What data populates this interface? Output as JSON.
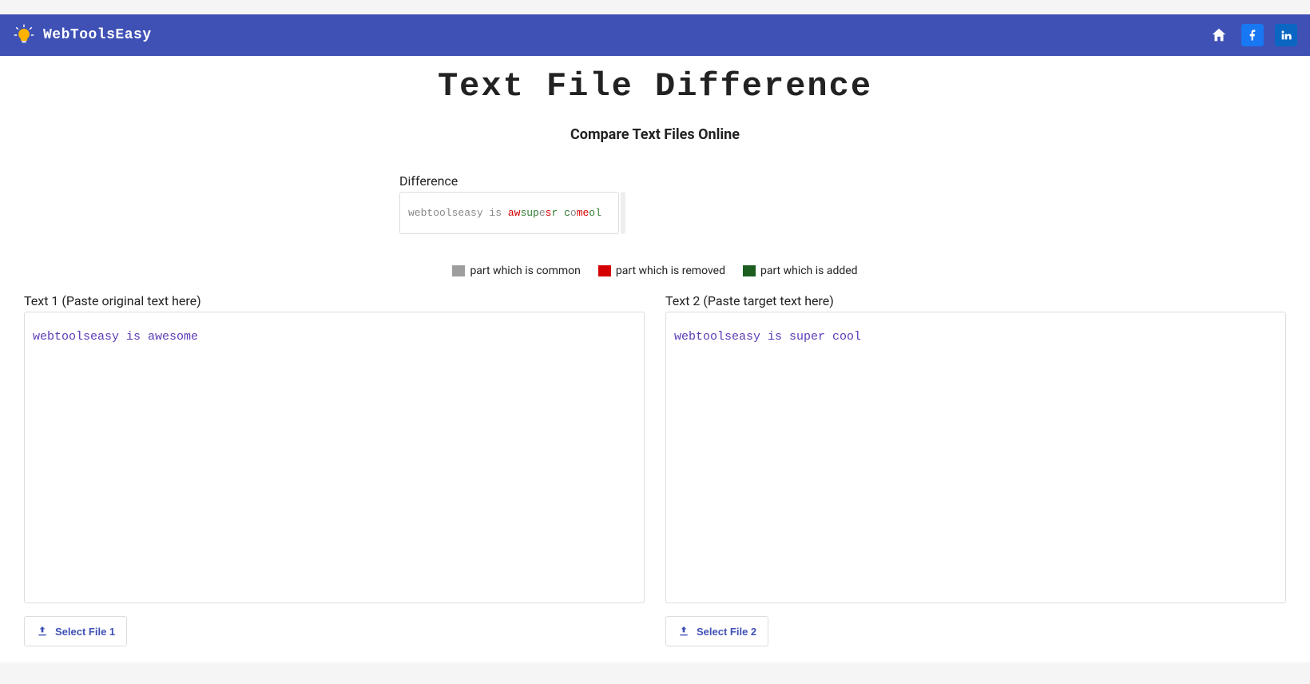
{
  "brand": {
    "name": "WebToolsEasy"
  },
  "nav": {
    "home_icon": "home-icon",
    "facebook_icon": "facebook-icon",
    "linkedin_icon": "linkedin-icon"
  },
  "page": {
    "title": "Text File Difference",
    "subtitle": "Compare Text Files Online"
  },
  "diff": {
    "label": "Difference",
    "segments": [
      {
        "text": "webtoolseasy is ",
        "kind": "common"
      },
      {
        "text": "aw",
        "kind": "removed"
      },
      {
        "text": "sup",
        "kind": "added"
      },
      {
        "text": "e",
        "kind": "common"
      },
      {
        "text": "s",
        "kind": "removed"
      },
      {
        "text": "r c",
        "kind": "added"
      },
      {
        "text": "o",
        "kind": "common"
      },
      {
        "text": "me",
        "kind": "removed"
      },
      {
        "text": "ol",
        "kind": "added"
      }
    ]
  },
  "legend": {
    "common": "part which is common",
    "removed": "part which is removed",
    "added": "part which is added"
  },
  "left": {
    "label": "Text 1 (Paste original text here)",
    "value": "webtoolseasy is awesome",
    "button": "Select File 1"
  },
  "right": {
    "label": "Text 2 (Paste target text here)",
    "value": "webtoolseasy is super cool",
    "button": "Select File 2"
  }
}
